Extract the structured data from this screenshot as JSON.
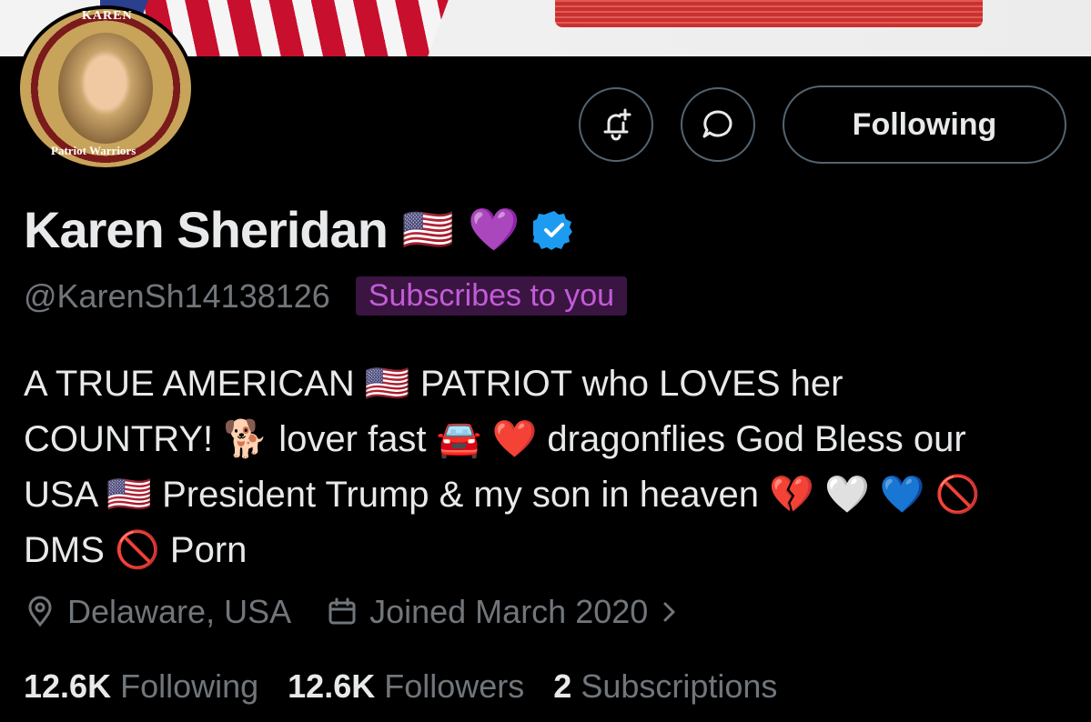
{
  "banner": {
    "avatar_top_text": "KAREN",
    "avatar_ring_text": "Patriot Warriors"
  },
  "actions": {
    "notify_icon": "bell-plus-icon",
    "message_icon": "message-bubble-icon",
    "follow_label": "Following"
  },
  "profile": {
    "name": "Karen Sheridan",
    "name_emojis": [
      "🇺🇸",
      "💜"
    ],
    "verified_icon": "verified-badge-icon",
    "handle": "@KarenSh14138126",
    "subscribes_badge": "Subscribes to you",
    "bio_lines": [
      "A TRUE AMERICAN 🇺🇸 PATRIOT who LOVES her",
      "COUNTRY! 🐕 lover fast 🚘 ❤️ dragonflies God Bless our",
      "USA 🇺🇸 President Trump & my son in heaven 💔 🤍 💙 🚫",
      "DMS 🚫 Porn"
    ],
    "location": "Delaware, USA",
    "joined": "Joined March 2020"
  },
  "stats": [
    {
      "num": "12.6K",
      "label": "Following"
    },
    {
      "num": "12.6K",
      "label": "Followers"
    },
    {
      "num": "2",
      "label": "Subscriptions"
    }
  ],
  "colors": {
    "background": "#000000",
    "text_primary": "#e7e9ea",
    "text_secondary": "#71767b",
    "verified_blue": "#1d9bf0",
    "badge_bg": "#3a1541",
    "badge_text": "#c35bd9",
    "border": "#536471"
  }
}
